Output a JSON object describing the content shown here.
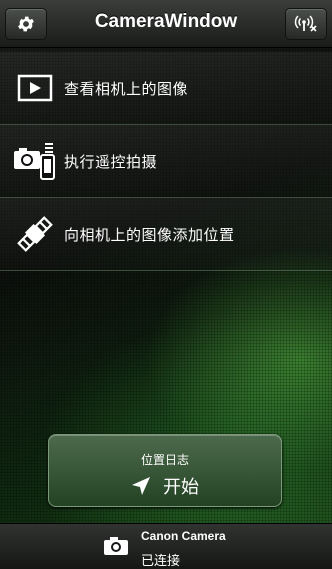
{
  "header": {
    "title": "CameraWindow",
    "settings_icon": "gear-icon",
    "wireless_icon": "wireless-disconnect-icon"
  },
  "menu": {
    "items": [
      {
        "label": "查看相机上的图像",
        "icon": "play-icon"
      },
      {
        "label": "执行遥控拍摄",
        "icon": "remote-camera-icon"
      },
      {
        "label": "向相机上的图像添加位置",
        "icon": "satellite-icon"
      }
    ]
  },
  "start_button": {
    "caption": "位置日志",
    "label": "开始",
    "icon": "location-arrow-icon"
  },
  "footer": {
    "camera_name": "Canon Camera",
    "status": "已连接",
    "icon": "camera-icon"
  },
  "colors": {
    "accent": "#3c7a34",
    "background": "#0b0d0b"
  }
}
